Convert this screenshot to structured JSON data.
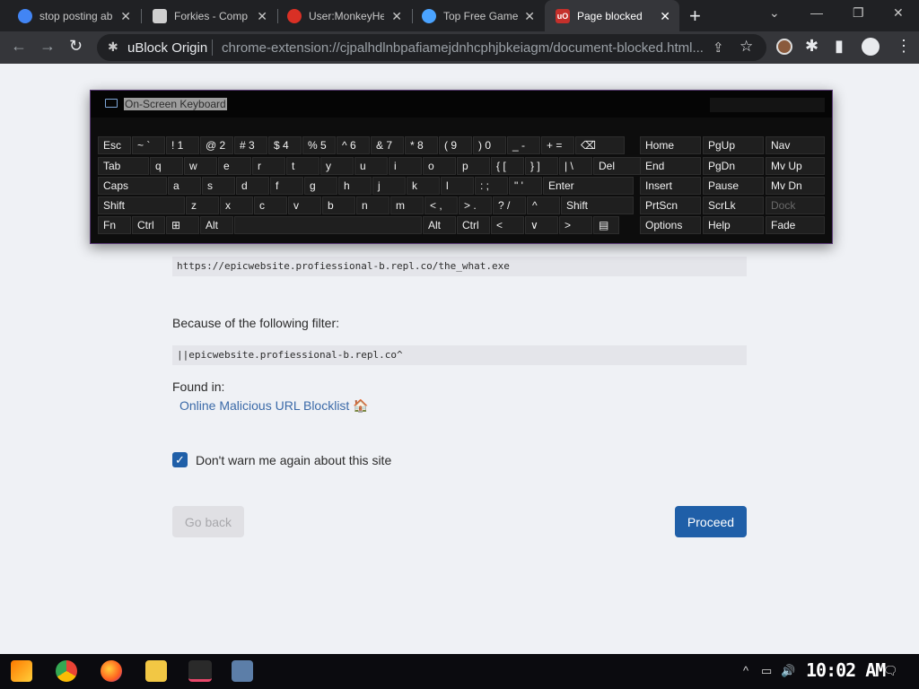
{
  "tabs": [
    {
      "title": "stop posting ab",
      "favicon_color": "#4285f4"
    },
    {
      "title": "Forkies - Comp",
      "favicon_color": "#cfcfcf"
    },
    {
      "title": "User:MonkeyHe",
      "favicon_color": "#d93025"
    },
    {
      "title": "Top Free Game",
      "favicon_color": "#4aa3ff"
    },
    {
      "title": "Page blocked",
      "favicon_color": "#c4302b",
      "favicon_text": "uO"
    }
  ],
  "tab_close": "✕",
  "new_tab_label": "+",
  "window_controls": {
    "caret": "⌄",
    "minimize": "—",
    "restore": "❐",
    "close": "✕"
  },
  "toolbar": {
    "back": "←",
    "forward": "→",
    "reload": "↻",
    "origin": "uBlock Origin",
    "url": "chrome-extension://cjpalhdlnbpafiamejdnhcphjbkeiagm/document-blocked.html...",
    "share": "⇪",
    "star": "☆",
    "extensions": "✱",
    "sidepanel": "▮",
    "menu": "⋮"
  },
  "page": {
    "blocked_url": "https://epicwebsite.profiessional-b.repl.co/the_what.exe",
    "filter_heading": "Because of the following filter:",
    "filter": "||epicwebsite.profiessional-b.repl.co^",
    "found_in_label": "Found in:",
    "list_name": "Online Malicious URL Blocklist 🏠",
    "dont_warn_label": "Don't warn me again about this site",
    "dont_warn_checked": true,
    "go_back_label": "Go back",
    "proceed_label": "Proceed"
  },
  "osk": {
    "title": "On-Screen Keyboard",
    "rows": [
      [
        {
          "label": "Esc"
        },
        {
          "label": "~ `",
          "small": true
        },
        {
          "label": "! 1"
        },
        {
          "label": "@ 2"
        },
        {
          "label": "# 3"
        },
        {
          "label": "$ 4"
        },
        {
          "label": "% 5"
        },
        {
          "label": "^ 6"
        },
        {
          "label": "& 7"
        },
        {
          "label": "* 8"
        },
        {
          "label": "( 9"
        },
        {
          "label": ") 0"
        },
        {
          "label": "_ -"
        },
        {
          "label": "+ ="
        },
        {
          "label": "⌫"
        }
      ],
      [
        {
          "label": "Tab"
        },
        {
          "label": "q"
        },
        {
          "label": "w"
        },
        {
          "label": "e"
        },
        {
          "label": "r"
        },
        {
          "label": "t"
        },
        {
          "label": "y"
        },
        {
          "label": "u"
        },
        {
          "label": "i"
        },
        {
          "label": "o"
        },
        {
          "label": "p"
        },
        {
          "label": "{ ["
        },
        {
          "label": "} ]"
        },
        {
          "label": "| \\"
        },
        {
          "label": "Del"
        }
      ],
      [
        {
          "label": "Caps"
        },
        {
          "label": "a"
        },
        {
          "label": "s"
        },
        {
          "label": "d"
        },
        {
          "label": "f"
        },
        {
          "label": "g"
        },
        {
          "label": "h"
        },
        {
          "label": "j"
        },
        {
          "label": "k"
        },
        {
          "label": "l"
        },
        {
          "label": ": ;"
        },
        {
          "label": "\" '"
        },
        {
          "label": "Enter"
        }
      ],
      [
        {
          "label": "Shift"
        },
        {
          "label": "z"
        },
        {
          "label": "x"
        },
        {
          "label": "c"
        },
        {
          "label": "v"
        },
        {
          "label": "b"
        },
        {
          "label": "n"
        },
        {
          "label": "m"
        },
        {
          "label": "< ,"
        },
        {
          "label": "> ."
        },
        {
          "label": "? /"
        },
        {
          "label": "^"
        },
        {
          "label": "Shift"
        }
      ],
      [
        {
          "label": "Fn"
        },
        {
          "label": "Ctrl"
        },
        {
          "label": "⊞"
        },
        {
          "label": "Alt"
        },
        {
          "label": ""
        },
        {
          "label": "Alt"
        },
        {
          "label": "Ctrl"
        },
        {
          "label": "<"
        },
        {
          "label": "∨"
        },
        {
          "label": ">"
        },
        {
          "label": "▤"
        }
      ]
    ],
    "nav_keys": [
      [
        "Home",
        "PgUp",
        "Nav"
      ],
      [
        "End",
        "PgDn",
        "Mv Up"
      ],
      [
        "Insert",
        "Pause",
        "Mv Dn"
      ],
      [
        "PrtScn",
        "ScrLk",
        "Dock"
      ],
      [
        "Options",
        "Help",
        "Fade"
      ]
    ]
  },
  "taskbar": {
    "apps": [
      "start",
      "chrome",
      "firefox",
      "files",
      "app",
      "remote"
    ],
    "tray": {
      "caret": "^",
      "network": "▭",
      "volume": "🔊",
      "notifications": "🗨"
    },
    "clock": "10:02 AM"
  }
}
